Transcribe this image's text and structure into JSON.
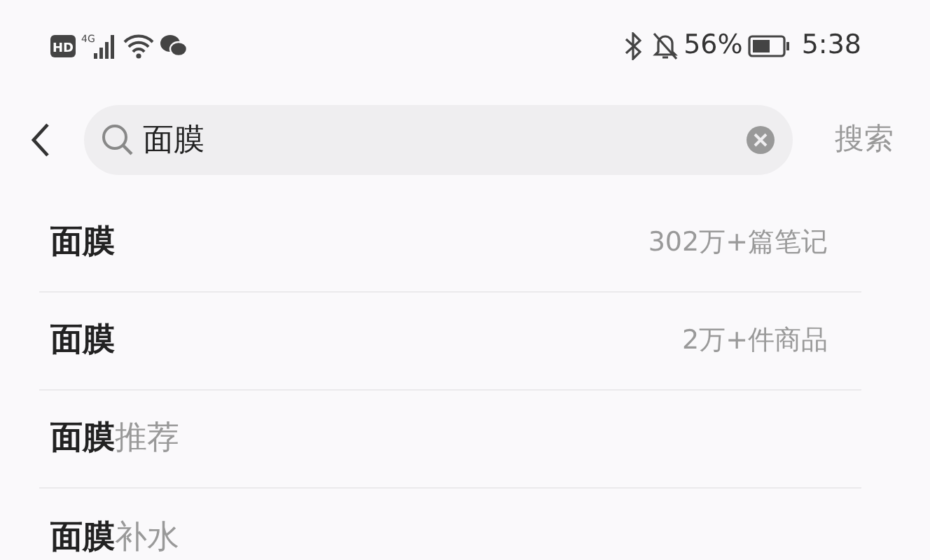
{
  "status_bar": {
    "hd": "HD",
    "network": "4G",
    "battery": "56%",
    "time": "5:38"
  },
  "search": {
    "value": "面膜",
    "submit": "搜索"
  },
  "suggestions": [
    {
      "text": "**面膜**",
      "meta": "302万+篇笔记"
    },
    {
      "text": "**面膜**",
      "meta": "2万+件商品"
    },
    {
      "text": "**面膜**推荐"
    },
    {
      "text": "**面膜**补水"
    }
  ]
}
